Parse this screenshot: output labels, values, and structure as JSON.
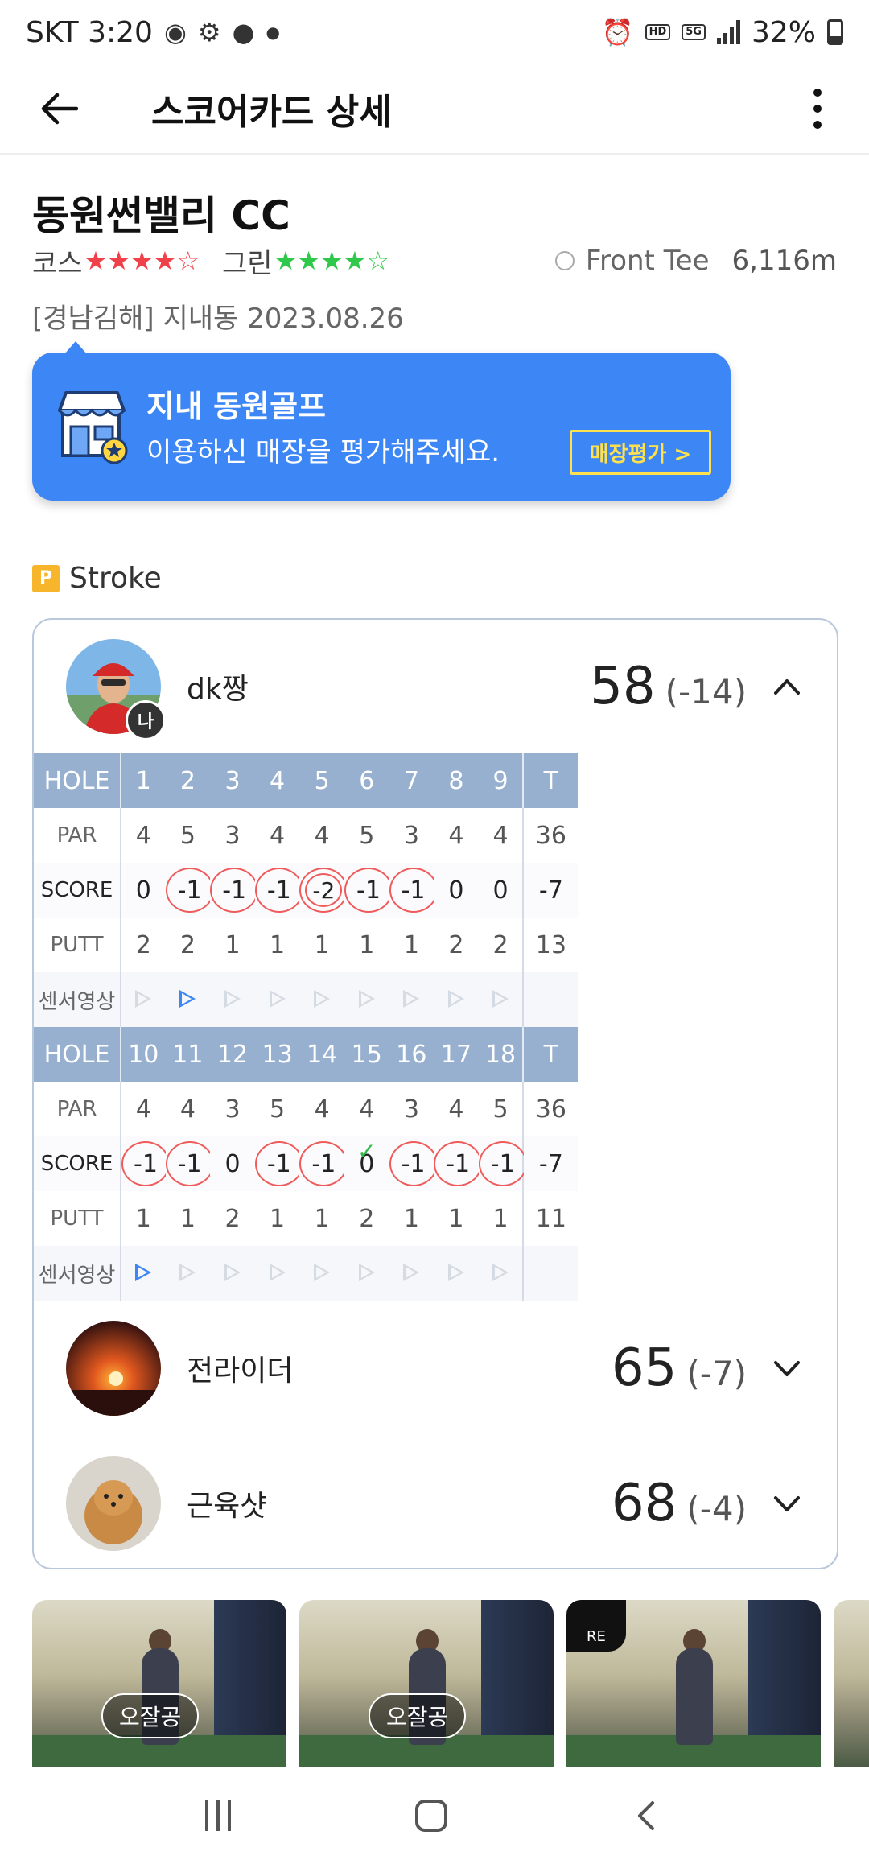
{
  "status_bar": {
    "carrier_time": "SKT 3:20",
    "hd_label": "HD",
    "fiveg_label": "5G",
    "battery": "32%"
  },
  "app_bar": {
    "title": "스코어카드 상세"
  },
  "course": {
    "name": "동원썬밸리 CC",
    "course_label": "코스",
    "course_rating": 4,
    "green_label": "그린",
    "green_rating": 4,
    "tee": "Front Tee",
    "distance": "6,116m",
    "location_date": "[경남김해] 지내동 2023.08.26"
  },
  "banner": {
    "title": "지내 동원골프",
    "subtitle": "이용하신 매장을 평가해주세요.",
    "button": "매장평가 >"
  },
  "mode": {
    "badge": "P",
    "label": "Stroke"
  },
  "main_player": {
    "name": "dk짱",
    "me_badge": "나",
    "total": "58",
    "diff": "(-14)"
  },
  "front_nine": {
    "hole_label": "HOLE",
    "holes": [
      "1",
      "2",
      "3",
      "4",
      "5",
      "6",
      "7",
      "8",
      "9"
    ],
    "total_label": "T",
    "par_label": "PAR",
    "par": [
      "4",
      "5",
      "3",
      "4",
      "4",
      "5",
      "3",
      "4",
      "4"
    ],
    "par_total": "36",
    "score_label": "SCORE",
    "score": [
      "0",
      "-1",
      "-1",
      "-1",
      "-2",
      "-1",
      "-1",
      "0",
      "0"
    ],
    "score_total": "-7",
    "putt_label": "PUTT",
    "putt": [
      "2",
      "2",
      "1",
      "1",
      "1",
      "1",
      "1",
      "2",
      "2"
    ],
    "putt_total": "13",
    "sensor_label": "센서영상"
  },
  "back_nine": {
    "hole_label": "HOLE",
    "holes": [
      "10",
      "11",
      "12",
      "13",
      "14",
      "15",
      "16",
      "17",
      "18"
    ],
    "total_label": "T",
    "par_label": "PAR",
    "par": [
      "4",
      "4",
      "3",
      "5",
      "4",
      "4",
      "3",
      "4",
      "5"
    ],
    "par_total": "36",
    "score_label": "SCORE",
    "score": [
      "-1",
      "-1",
      "0",
      "-1",
      "-1",
      "0",
      "-1",
      "-1",
      "-1"
    ],
    "score_total": "-7",
    "putt_label": "PUTT",
    "putt": [
      "1",
      "1",
      "2",
      "1",
      "1",
      "2",
      "1",
      "1",
      "1"
    ],
    "putt_total": "11",
    "sensor_label": "센서영상"
  },
  "other_players": [
    {
      "name": "전라이더",
      "total": "65",
      "diff": "(-7)"
    },
    {
      "name": "근육샷",
      "total": "68",
      "diff": "(-4)"
    }
  ],
  "thumbnails": [
    {
      "chip": "오잘공"
    },
    {
      "chip": "오잘공"
    },
    {
      "re": "RE"
    }
  ],
  "colors": {
    "accent_blue": "#3d86f5",
    "header_blue": "#97b0d0",
    "star_red": "#f0414b",
    "star_green": "#2fc84a",
    "button_yellow": "#ffe14d"
  }
}
